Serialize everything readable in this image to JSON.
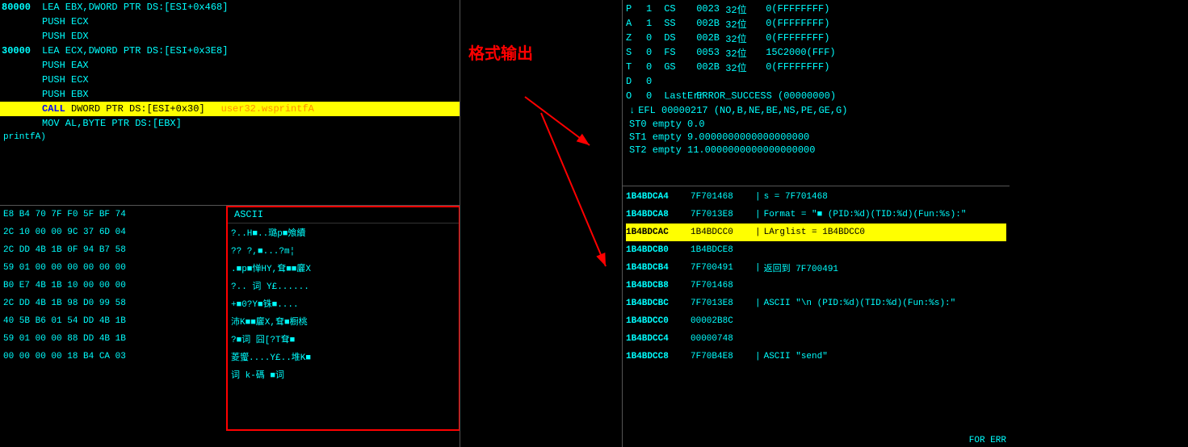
{
  "disasm": {
    "rows": [
      {
        "addr": "80000",
        "instr": "LEA EBX,DWORD PTR DS:[ESI+0x468]",
        "highlighted": false
      },
      {
        "addr": "",
        "instr": "PUSH ECX",
        "highlighted": false
      },
      {
        "addr": "",
        "instr": "PUSH EDX",
        "highlighted": false
      },
      {
        "addr": "30000",
        "instr": "LEA ECX,DWORD PTR DS:[ESI+0x3E8]",
        "highlighted": false
      },
      {
        "addr": "",
        "instr": "PUSH EAX",
        "highlighted": false
      },
      {
        "addr": "",
        "instr": "PUSH ECX",
        "highlighted": false
      },
      {
        "addr": "",
        "instr": "PUSH EBX",
        "highlighted": false
      },
      {
        "addr": "",
        "instr": "CALL DWORD PTR DS:[ESI+0x30]",
        "comment": "user32.wsprintfA",
        "highlighted": true,
        "isCall": true
      },
      {
        "addr": "",
        "instr": "MOV AL,BYTE PTR DS:[EBX]",
        "highlighted": false
      }
    ],
    "printfa_label": "printfA)"
  },
  "hex": {
    "header_ascii": "ASCII",
    "bytes_rows": [
      "E8 B4 70 7F F0 5F BF 74",
      "2C 10 00 00 9C 37 6D 04",
      "2C DD 4B 1B 0F 94 B7 58",
      "59 01 00 00 00 00 00 00",
      "B0 E7 4B 1B 10 00 00 00",
      "2C DD 4B 1B 98 D0 99 58",
      "40 5B B6 01 54 DD 4B 1B",
      "59 01 00 00 88 DD 4B 1B",
      "00 00 00 00 18 B4 CA 03"
    ],
    "ascii_rows": [
      "?..H■..璐p■飧續",
      "??  ?,■...?m¦",
      ".■p■惮HY,耷■■廲X",
      "?.. 词 Y£......",
      "+■0?Y■铢■....",
      "沛K■■廲X,耷■橱桃",
      "?■词 囧[?T耷■",
      "菱蠁....Y£..堆K■",
      "词 k-碼    ■词"
    ]
  },
  "annotation": {
    "text": "格式输出"
  },
  "registers": {
    "rows": [
      {
        "flag": "P",
        "val": "1",
        "seg": "CS",
        "seg2": "0023",
        "bits": "32位",
        "data": "0(FFFFFFFF)"
      },
      {
        "flag": "A",
        "val": "1",
        "seg": "SS",
        "seg2": "002B",
        "bits": "32位",
        "data": "0(FFFFFFFF)"
      },
      {
        "flag": "Z",
        "val": "0",
        "seg": "DS",
        "seg2": "002B",
        "bits": "32位",
        "data": "0(FFFFFFFF)"
      },
      {
        "flag": "S",
        "val": "0",
        "seg": "FS",
        "seg2": "0053",
        "bits": "32位",
        "data": "15C2000(FFF)"
      },
      {
        "flag": "T",
        "val": "0",
        "seg": "GS",
        "seg2": "002B",
        "bits": "32位",
        "data": "0(FFFFFFFF)"
      },
      {
        "flag": "D",
        "val": "0",
        "seg": "",
        "seg2": "",
        "bits": "",
        "data": ""
      },
      {
        "flag": "O",
        "val": "0",
        "seg": "LastErr",
        "seg2": "ERROR_SUCCESS",
        "bits": "(00000000)",
        "data": ""
      }
    ],
    "efl": "EFL 00000217 (NO,B,NE,BE,NS,PE,GE,G)",
    "st_rows": [
      "ST0 empty 0.0",
      "ST1 empty 9.0000000000000000000",
      "ST2 empty 11.0000000000000000000"
    ]
  },
  "stack": {
    "rows": [
      {
        "addr": "1B4BDCA4",
        "val": "7F701468",
        "comment": "s = 7F701468",
        "highlighted": false
      },
      {
        "addr": "1B4BDCA8",
        "val": "7F7013E8",
        "comment": "Format = \"■ (PID:%d)(TID:%d)(Fun:%s):\"",
        "highlighted": false
      },
      {
        "addr": "1B4BDCAC",
        "val": "1B4BDCC0",
        "comment": "LArglist = 1B4BDCC0",
        "highlighted": true
      },
      {
        "addr": "1B4BDCB0",
        "val": "1B4BDCE8",
        "comment": "",
        "highlighted": false
      },
      {
        "addr": "1B4BDCB4",
        "val": "7F700491",
        "comment": "返回到 7F700491",
        "highlighted": false
      },
      {
        "addr": "1B4BDCB8",
        "val": "7F701468",
        "comment": "",
        "highlighted": false
      },
      {
        "addr": "1B4BDCBC",
        "val": "7F7013E8",
        "comment": "ASCII \"\\n (PID:%d)(TID:%d)(Fun:%s):\"",
        "highlighted": false
      },
      {
        "addr": "1B4BDCC0",
        "val": "00002B8C",
        "comment": "",
        "highlighted": false
      },
      {
        "addr": "1B4BDCC4",
        "val": "00000748",
        "comment": "",
        "highlighted": false
      },
      {
        "addr": "1B4BDCC8",
        "val": "7F70B4E8",
        "comment": "ASCII \"send\"",
        "highlighted": false
      }
    ]
  }
}
